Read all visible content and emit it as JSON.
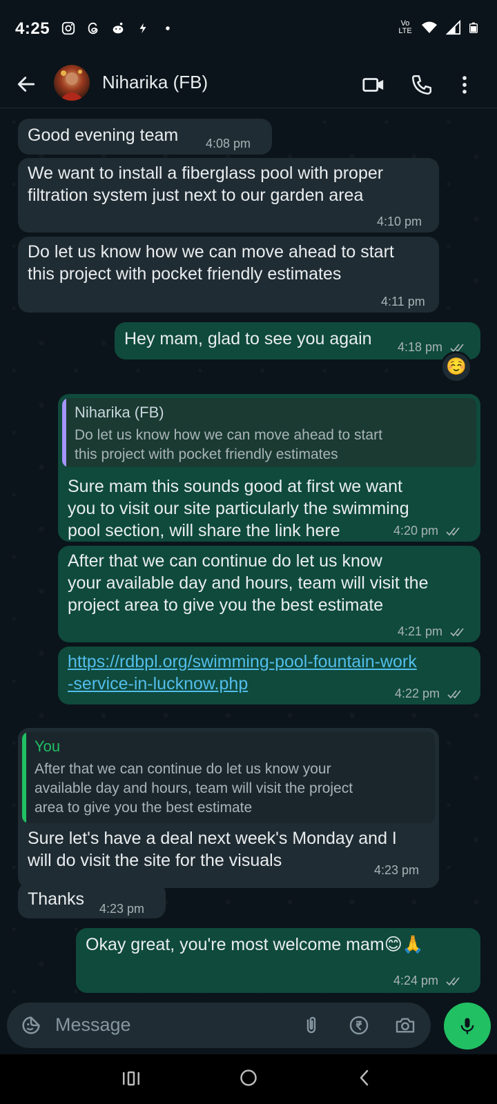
{
  "status_bar": {
    "time": "4:25",
    "network_label": "Vo LTE"
  },
  "header": {
    "contact_name": "Niharika (FB)"
  },
  "messages": [
    {
      "dir": "in",
      "text": "Good evening team",
      "time": "4:08 pm"
    },
    {
      "dir": "in",
      "text": "We want to install a fiberglass pool with proper\nfiltration system just next to our garden area",
      "time": "4:10 pm"
    },
    {
      "dir": "in",
      "text": "Do let us know how we can move ahead to start\nthis project with pocket friendly estimates",
      "time": "4:11 pm"
    },
    {
      "dir": "out",
      "text": "Hey mam, glad to see you again",
      "time": "4:18 pm",
      "reaction": "☺️"
    },
    {
      "dir": "out",
      "quote_name": "Niharika (FB)",
      "quote_text": "Do let us know how we can move ahead to start\nthis project with pocket friendly estimates",
      "text": "Sure mam this sounds good at first we want\nyou to visit our site particularly the swimming\npool section, will share the link here",
      "time": "4:20 pm"
    },
    {
      "dir": "out",
      "text": "After that we can continue do let us know\nyour available day and hours, team will visit the\nproject area to give you the best estimate",
      "time": "4:21 pm"
    },
    {
      "dir": "out",
      "text": "https://rdbpl.org/swimming-pool-fountain-work\n-service-in-lucknow.php",
      "time": "4:22 pm"
    },
    {
      "dir": "in",
      "quote_name": "You",
      "quote_text": "After that we can continue do let us know your\navailable day and hours, team will visit the project\narea to give you the best estimate",
      "text": "Sure let's have a deal next week's Monday and I\nwill do visit the site for the visuals",
      "time": "4:23 pm"
    },
    {
      "dir": "in",
      "text": "Thanks",
      "time": "4:23 pm"
    },
    {
      "dir": "out",
      "text": "Okay great, you're most welcome mam😊🙏",
      "time": "4:24 pm"
    }
  ],
  "composer": {
    "placeholder": "Message"
  },
  "colors": {
    "incoming_bubble": "#202c33",
    "outgoing_bubble": "#0f4a3c",
    "accent_green": "#21c063",
    "link": "#53bdeb"
  }
}
